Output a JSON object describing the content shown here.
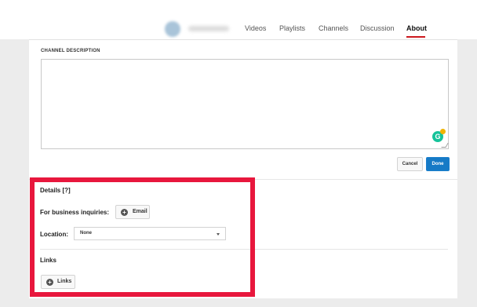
{
  "nav": {
    "tabs": [
      "Videos",
      "Playlists",
      "Channels",
      "Discussion",
      "About"
    ],
    "active_tab": "About"
  },
  "description": {
    "section_label": "CHANNEL DESCRIPTION",
    "value": "",
    "cancel_label": "Cancel",
    "done_label": "Done",
    "grammarly_letter": "G"
  },
  "details": {
    "heading": "Details [?]",
    "business_label": "For business inquiries:",
    "email_button_label": "Email",
    "location_label": "Location:",
    "location_value": "None"
  },
  "links": {
    "heading": "Links",
    "button_label": "Links"
  },
  "colors": {
    "accent_red": "#cc181e",
    "done_blue": "#167ac6",
    "highlight_red": "#e8173d"
  }
}
